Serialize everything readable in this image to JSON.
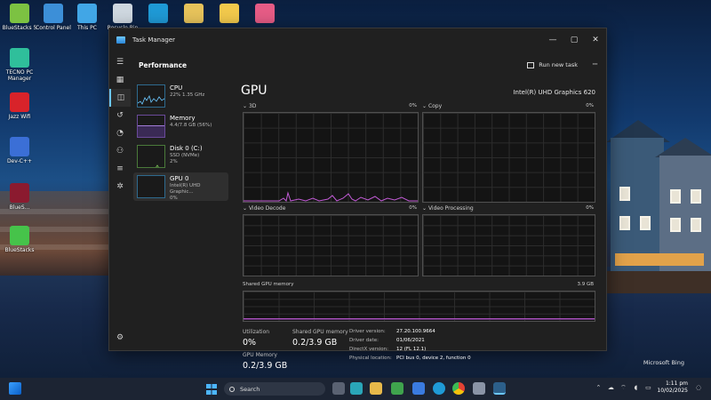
{
  "desktop": {
    "icons": [
      {
        "label": "BlueStacks 5",
        "color": "#7cc242"
      },
      {
        "label": "Control Panel",
        "color": "#3c8fd8"
      },
      {
        "label": "This PC",
        "color": "#41a6e6"
      },
      {
        "label": "Recycle Bin",
        "color": "#cfd8e0"
      },
      {
        "label": "",
        "color": "#1f9ad6"
      },
      {
        "label": "",
        "color": "#e7c35b"
      },
      {
        "label": "",
        "color": "#f2c94c"
      },
      {
        "label": "",
        "color": "#e65c86"
      },
      {
        "label": "TECNO PC Manager",
        "color": "#2fbf9b"
      },
      {
        "label": "Jazz Wifi",
        "color": "#d8232a"
      },
      {
        "label": "Dev-C++",
        "color": "#3b6fd6"
      },
      {
        "label": "BlueS...",
        "color": "#8b1a2f"
      },
      {
        "label": "BlueStacks",
        "color": "#46c34a"
      }
    ],
    "watermark": "Microsoft Bing"
  },
  "window": {
    "title": "Task Manager",
    "controls": {
      "minimize": "—",
      "maximize": "▢",
      "close": "✕"
    }
  },
  "header": {
    "title": "Performance",
    "run_task_label": "Run new task",
    "more_label": "···"
  },
  "nav_icons": [
    "menu-icon",
    "processes-icon",
    "performance-icon",
    "app-history-icon",
    "startup-icon",
    "users-icon",
    "details-icon",
    "services-icon",
    "settings-icon"
  ],
  "devices": [
    {
      "name": "CPU",
      "sub": "22%  1.35 GHz",
      "type": "cpu"
    },
    {
      "name": "Memory",
      "sub": "4.4/7.8 GB (56%)",
      "type": "mem"
    },
    {
      "name": "Disk 0 (C:)",
      "sub": "SSD (NVMe)",
      "sub2": "2%",
      "type": "disk"
    },
    {
      "name": "GPU 0",
      "sub": "Intel(R) UHD Graphic...",
      "sub2": "0%",
      "type": "gpu"
    }
  ],
  "gpu": {
    "title": "GPU",
    "model": "Intel(R) UHD Graphics 620",
    "panels": [
      {
        "label": "3D",
        "pct": "0%"
      },
      {
        "label": "Copy",
        "pct": "0%"
      },
      {
        "label": "Video Decode",
        "pct": "0%"
      },
      {
        "label": "Video Processing",
        "pct": "0%"
      }
    ],
    "shared": {
      "label": "Shared GPU memory",
      "max": "3.9 GB"
    },
    "stats": {
      "utilization_label": "Utilization",
      "utilization": "0%",
      "shared_mem_label": "Shared GPU memory",
      "shared_mem": "0.2/3.9 GB",
      "gpu_mem_label": "GPU Memory",
      "gpu_mem": "0.2/3.9 GB"
    },
    "info": [
      {
        "k": "Driver version:",
        "v": "27.20.100.9664"
      },
      {
        "k": "Driver date:",
        "v": "01/06/2021"
      },
      {
        "k": "DirectX version:",
        "v": "12 (FL 12.1)"
      },
      {
        "k": "Physical location:",
        "v": "PCI bus 0, device 2, function 0"
      }
    ]
  },
  "taskbar": {
    "search_label": "Search",
    "time": "1:11 pm",
    "date": "10/02/2025"
  }
}
